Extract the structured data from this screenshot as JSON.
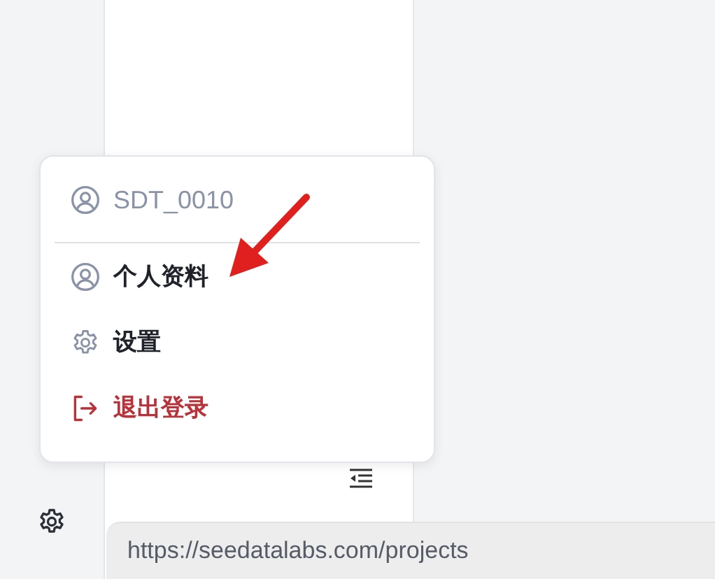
{
  "user_menu": {
    "username": "SDT_0010",
    "items": [
      {
        "label": "个人资料",
        "kind": "profile"
      },
      {
        "label": "设置",
        "kind": "settings"
      },
      {
        "label": "退出登录",
        "kind": "logout"
      }
    ]
  },
  "status_bar": {
    "url": "https://seedatalabs.com/projects"
  }
}
